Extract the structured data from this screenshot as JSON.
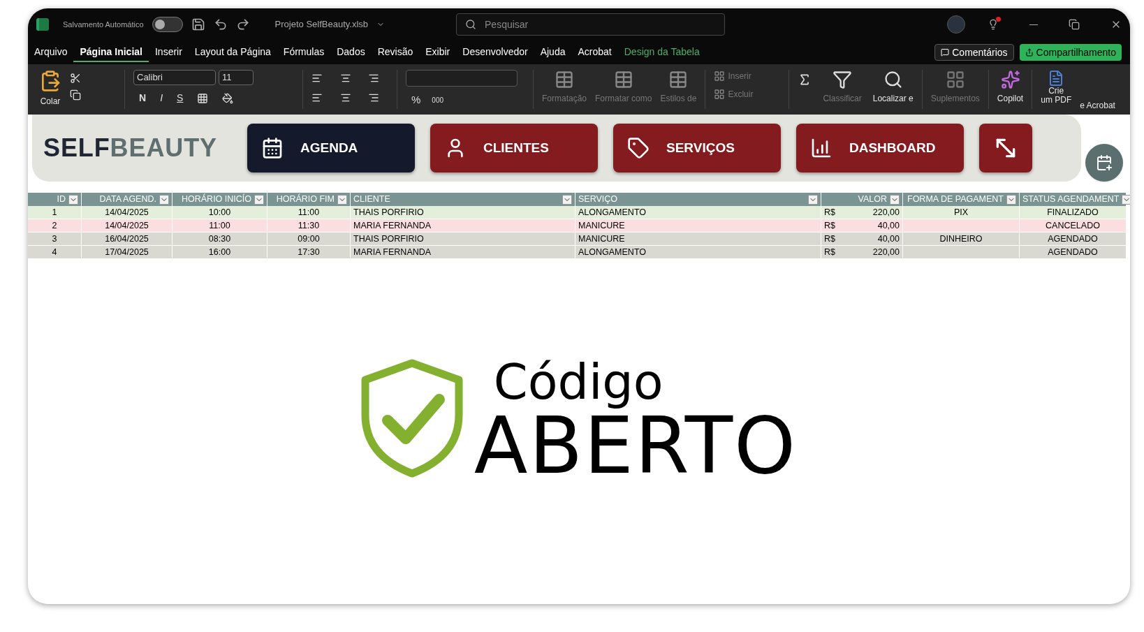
{
  "titlebar": {
    "autosave_label": "Salvamento Automático",
    "autosave_on": false,
    "filename": "Projeto SelfBeauty.xlsb",
    "search_placeholder": "Pesquisar"
  },
  "menu": [
    {
      "label": "Arquivo",
      "selected": false,
      "kind": "normal"
    },
    {
      "label": "Página Inicial",
      "selected": true,
      "kind": "normal"
    },
    {
      "label": "Inserir",
      "selected": false,
      "kind": "normal"
    },
    {
      "label": "Layout da Página",
      "selected": false,
      "kind": "normal"
    },
    {
      "label": "Fórmulas",
      "selected": false,
      "kind": "normal"
    },
    {
      "label": "Dados",
      "selected": false,
      "kind": "normal"
    },
    {
      "label": "Revisão",
      "selected": false,
      "kind": "normal"
    },
    {
      "label": "Exibir",
      "selected": false,
      "kind": "normal"
    },
    {
      "label": "Desenvolvedor",
      "selected": false,
      "kind": "normal"
    },
    {
      "label": "Ajuda",
      "selected": false,
      "kind": "normal"
    },
    {
      "label": "Acrobat",
      "selected": false,
      "kind": "normal"
    },
    {
      "label": "Design da Tabela",
      "selected": false,
      "kind": "contextual"
    }
  ],
  "header_buttons": {
    "comments": "Comentários",
    "share": "Compartilhamento"
  },
  "ribbon": {
    "paste": "Colar",
    "font": "Calibri",
    "size": "11",
    "format_buttons": [
      "N",
      "I",
      "S"
    ],
    "percent": "%",
    "thousands": "000",
    "styles": [
      "Formatação",
      "Formatar como",
      "Estilos de"
    ],
    "cells": [
      {
        "label": "Inserir",
        "disabled": true
      },
      {
        "label": "Excluir",
        "disabled": true
      }
    ],
    "sort": {
      "label": "Classificar",
      "disabled": true
    },
    "find": {
      "label": "Localizar e",
      "disabled": false
    },
    "addins": {
      "label": "Suplementos",
      "disabled": true
    },
    "copilot": "Copilot",
    "pdf": [
      "Crie",
      "um PDF"
    ],
    "acrobat": "e Acrobat"
  },
  "app": {
    "logo_dark": "SELF",
    "logo_light": "BEAUTY",
    "nav": [
      {
        "label": "AGENDA",
        "kind": "calendar",
        "selected": true
      },
      {
        "label": "CLIENTES",
        "kind": "person",
        "selected": false
      },
      {
        "label": "SERVIÇOS",
        "kind": "tag",
        "selected": false
      },
      {
        "label": "DASHBOARD",
        "kind": "chart",
        "selected": false
      },
      {
        "kind": "expand",
        "selected": false
      }
    ]
  },
  "table": {
    "columns": [
      "ID",
      "DATA AGEND.",
      "HORÁRIO INICÍO",
      "HORÁRIO FIM",
      "CLIENTE",
      "SERVIÇO",
      "VALOR",
      "FORMA DE PAGAMENT",
      "STATUS AGENDAMENT"
    ],
    "rows": [
      {
        "kind": "done",
        "id": "1",
        "date": "14/04/2025",
        "start": "10:00",
        "end": "11:00",
        "client": "THAIS PORFIRIO",
        "service": "ALONGAMENTO",
        "currency": "R$",
        "amount": "220,00",
        "payment": "PIX",
        "status": "FINALIZADO"
      },
      {
        "kind": "cancelled",
        "id": "2",
        "date": "14/04/2025",
        "start": "11:00",
        "end": "11:30",
        "client": "MARIA FERNANDA",
        "service": "MANICURE",
        "currency": "R$",
        "amount": "40,00",
        "status": "CANCELADO"
      },
      {
        "kind": "scheduled",
        "id": "3",
        "date": "16/04/2025",
        "start": "08:30",
        "end": "09:00",
        "client": "THAIS PORFIRIO",
        "service": "MANICURE",
        "currency": "R$",
        "amount": "40,00",
        "payment": "DINHEIRO",
        "status": "AGENDADO"
      },
      {
        "kind": "scheduled",
        "id": "4",
        "date": "17/04/2025",
        "start": "16:00",
        "end": "17:30",
        "client": "MARIA FERNANDA",
        "service": "ALONGAMENTO",
        "currency": "R$",
        "amount": "220,00",
        "status": "AGENDADO"
      }
    ]
  },
  "banner": {
    "line1": "Código",
    "line2": "ABERTO"
  }
}
